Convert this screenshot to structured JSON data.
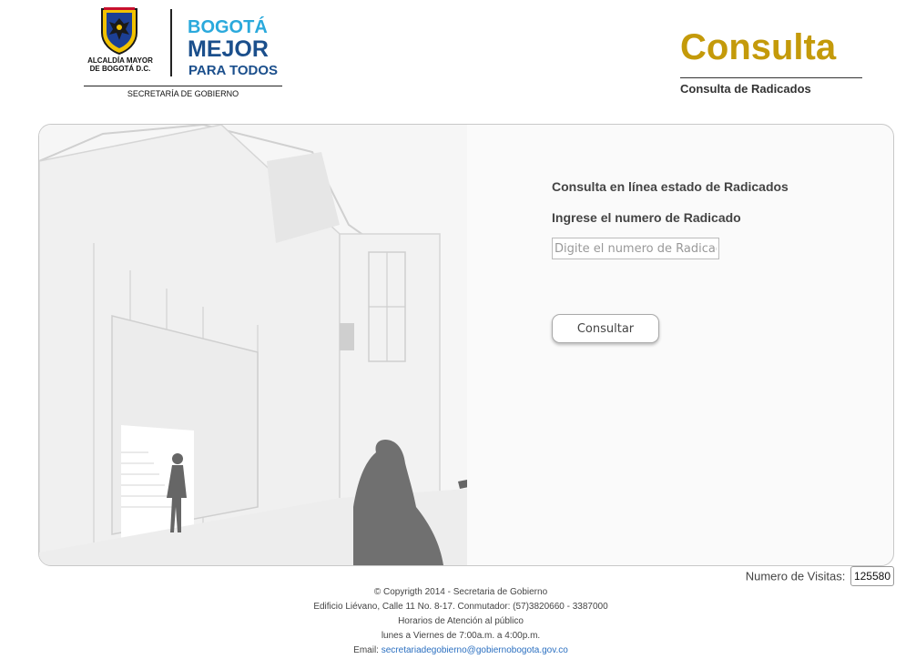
{
  "header": {
    "alcaldia_line1": "ALCALDÍA MAYOR",
    "alcaldia_line2": "DE BOGOTÁ D.C.",
    "bogota_line1": "BOGOTÁ",
    "bogota_line2": "MEJOR",
    "bogota_line3": "PARA TODOS",
    "secretaria": "SECRETARÍA DE GOBIERNO",
    "title": "Consulta",
    "subtitle": "Consulta de Radicados"
  },
  "form": {
    "heading_online": "Consulta en línea estado de Radicados",
    "heading_ingrese": "Ingrese el numero de Radicado",
    "radicado_value": "",
    "radicado_placeholder": "Digite el numero de Radicado",
    "submit_label": "Consultar"
  },
  "counter": {
    "label": "Numero de Visitas:",
    "value": "125580"
  },
  "footer": {
    "copyright": "© Copyrigth 2014 - Secretaria de Gobierno",
    "address": "Edificio Liévano, Calle 11 No. 8-17. Conmutador: (57)3820660 - 3387000",
    "hours_title": "Horarios de Atención al público",
    "hours": "lunes a Viernes de 7:00a.m. a 4:00p.m.",
    "email_label": "Email:",
    "email": "secretariadegobierno@gobiernobogota.gov.co"
  },
  "colors": {
    "title_gold": "#c49a0a",
    "bogota_blue_light": "#2aa9dc",
    "bogota_blue_dark": "#1b4f8c",
    "link_blue": "#2a6fc0"
  },
  "icons": [
    "alcaldia-shield-icon",
    "bogota-logo-icon"
  ]
}
